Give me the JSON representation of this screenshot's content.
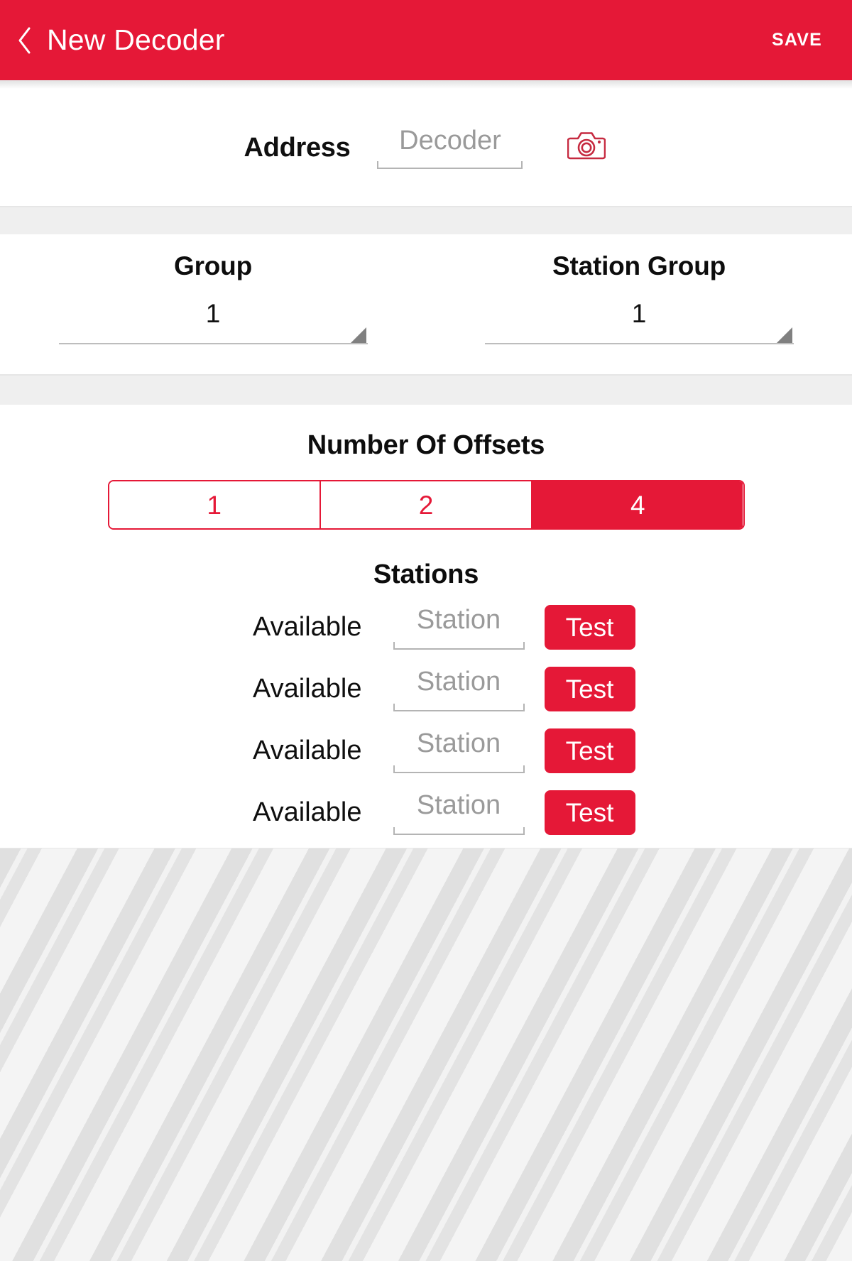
{
  "colors": {
    "brand_red": "#e51837",
    "divider_grey": "#efefef",
    "placeholder_grey": "#9a9a9a"
  },
  "appbar": {
    "back_icon": "chevron-left-icon",
    "title": "New Decoder",
    "save_label": "SAVE"
  },
  "address": {
    "label": "Address",
    "input_value": "",
    "input_placeholder": "Decoder",
    "camera_icon": "camera-icon"
  },
  "groups": [
    {
      "title": "Group",
      "value": "1"
    },
    {
      "title": "Station Group",
      "value": "1"
    }
  ],
  "offsets": {
    "title": "Number Of Offsets",
    "options": [
      {
        "label": "1",
        "selected": false
      },
      {
        "label": "2",
        "selected": false
      },
      {
        "label": "4",
        "selected": true
      }
    ]
  },
  "stations": {
    "title": "Stations",
    "rows": [
      {
        "status": "Available",
        "input_value": "",
        "input_placeholder": "Station",
        "test_label": "Test"
      },
      {
        "status": "Available",
        "input_value": "",
        "input_placeholder": "Station",
        "test_label": "Test"
      },
      {
        "status": "Available",
        "input_value": "",
        "input_placeholder": "Station",
        "test_label": "Test"
      },
      {
        "status": "Available",
        "input_value": "",
        "input_placeholder": "Station",
        "test_label": "Test"
      }
    ]
  }
}
